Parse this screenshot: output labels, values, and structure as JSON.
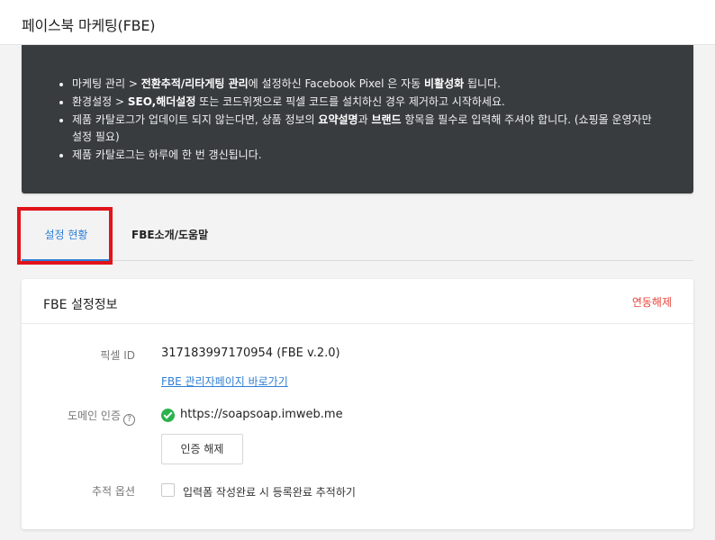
{
  "header": {
    "title": "페이스북 마케팅(FBE)"
  },
  "notice": {
    "items": [
      {
        "pre": "마케팅 관리 > ",
        "bold1": "전환추적/리타게팅 관리",
        "mid": "에 설정하신 Facebook Pixel 은 자동 ",
        "bold2": "비활성화",
        "post": " 됩니다."
      },
      {
        "pre": "환경설정 > ",
        "bold1": "SEO,해더설정",
        "mid": " 또는 코드위젯으로 픽셀 코드를 설치하신 경우 제거하고 시작하세요.",
        "bold2": "",
        "post": ""
      },
      {
        "pre": "제품 카탈로그가 업데이트 되지 않는다면, 상품 정보의 ",
        "bold1": "요약설명",
        "mid": "과 ",
        "bold2": "브랜드",
        "post": " 항목을 필수로 입력해 주셔야 합니다. (쇼핑몰 운영자만 설정 필요)"
      },
      {
        "pre": "제품 카탈로그는 하루에 한 번 갱신됩니다.",
        "bold1": "",
        "mid": "",
        "bold2": "",
        "post": ""
      }
    ]
  },
  "tabs": [
    {
      "label": "설정 현황",
      "active": true
    },
    {
      "label": "FBE소개/도움말",
      "active": false
    }
  ],
  "card": {
    "title": "FBE 설정정보",
    "unlink_label": "연동해제",
    "pixel": {
      "label": "픽셀 ID",
      "value": "317183997170954 (FBE v.2.0)",
      "link_label": "FBE 관리자페이지 바로가기"
    },
    "domain": {
      "label": "도메인 인증",
      "help_glyph": "?",
      "value": "https://soapsoap.imweb.me",
      "button_label": "인증 해제"
    },
    "tracking": {
      "label": "추적 옵션",
      "checkbox_label": "입력폼 작성완료 시 등록완료 추적하기",
      "checked": false
    }
  },
  "colors": {
    "accent": "#2f7fd6",
    "danger": "#e8453c",
    "success": "#2bb24c",
    "highlight": "#e0141a",
    "notice_bg": "#383c3e"
  }
}
